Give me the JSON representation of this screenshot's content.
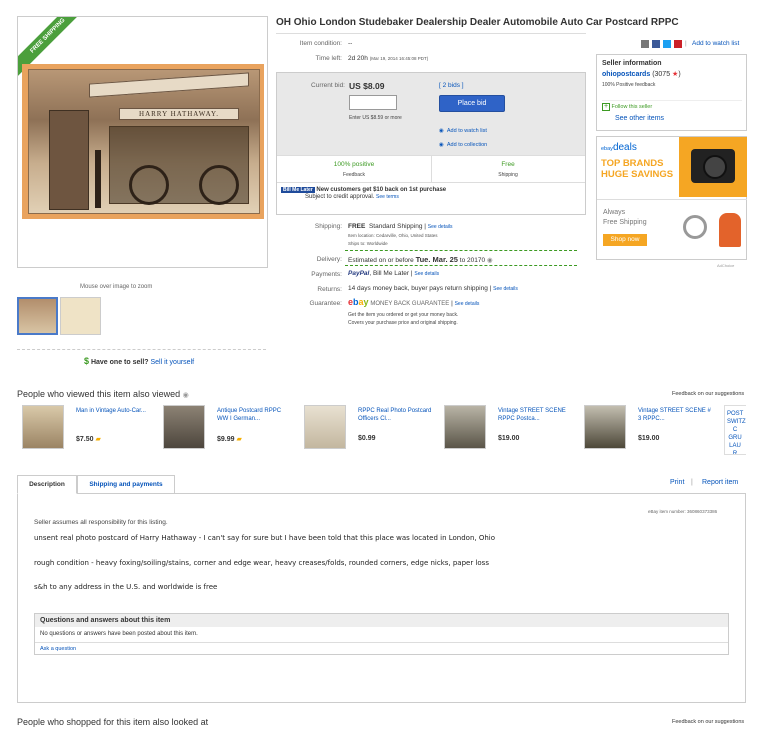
{
  "title": "OH Ohio London Studebaker Dealership Dealer Automobile Auto Car Postcard RPPC",
  "image": {
    "ribbon": "FREE SHIPPING",
    "sign_text": "HARRY HATHAWAY.",
    "zoom_hint": "Mouse over image to zoom"
  },
  "sell": {
    "prompt": "Have one to sell?",
    "link": "Sell it yourself",
    "icon": "$"
  },
  "details": {
    "condition_label": "Item condition:",
    "condition_value": "--",
    "time_left_label": "Time left:",
    "time_left_value": "2d 20h",
    "time_left_end": "(Mar 19, 2014   16:45:08 PDT)"
  },
  "bid": {
    "current_label": "Current bid:",
    "price": "US $8.09",
    "bids": "[ 2 bids ]",
    "hint": "Enter US $8.59 or more",
    "button": "Place bid",
    "watch": "Add to watch list",
    "collection": "Add to collection"
  },
  "feedback": {
    "positive": "100% positive",
    "positive_sub": "Feedback",
    "shipping": "Free",
    "shipping_sub": "Shipping"
  },
  "billme": {
    "logo": "Bill Me Later",
    "headline": "New customers get $10 back on 1st purchase",
    "sub": "Subject to credit approval.",
    "terms": "See terms"
  },
  "shipping": {
    "label": "Shipping:",
    "free": "FREE",
    "method": "Standard Shipping",
    "details": "See details",
    "location": "Item location:  Cedarville, Ohio, United States",
    "ships_to": "Ships to:  Worldwide"
  },
  "delivery": {
    "label": "Delivery:",
    "text": "Estimated on or before",
    "date": "Tue. Mar. 25",
    "zip": "to 20170"
  },
  "payments": {
    "label": "Payments:",
    "paypal": "PayPal",
    "bml": "Bill Me Later",
    "details": "See details"
  },
  "returns": {
    "label": "Returns:",
    "text": "14 days money back, buyer pays return shipping",
    "details": "See details"
  },
  "guarantee": {
    "label": "Guarantee:",
    "logo": "ebay",
    "text": "MONEY BACK GUARANTEE",
    "details": "See details",
    "line1": "Get the item you ordered or get your money back.",
    "line2": "Covers your purchase price and original shipping."
  },
  "share": {
    "watch": "Add to watch list",
    "sep": "|"
  },
  "seller": {
    "heading": "Seller information",
    "name": "ohiopostcards",
    "score": "(3075",
    "score_end": ")",
    "positive": "100% Positive feedback",
    "follow": "Follow this seller",
    "other": "See other items"
  },
  "ad": {
    "brand": "ebay",
    "deals": "deals",
    "headline": "TOP BRANDS HUGE SAVINGS",
    "always": "Always",
    "free": "Free Shipping",
    "button": "Shop now",
    "feedback": "AdChoice"
  },
  "viewed": {
    "title": "People who viewed this item also viewed",
    "feedback": "Feedback on our suggestions",
    "items": [
      {
        "title": "Man in Vintage Auto-Car...",
        "price": "$7.50"
      },
      {
        "title": "Antique Postcard RPPC WW I German...",
        "price": "$9.99"
      },
      {
        "title": "RPPC Real Photo Postcard Officers Cl...",
        "price": "$0.99"
      },
      {
        "title": "Vintage STREET SCENE RPPC Postca...",
        "price": "$19.00"
      },
      {
        "title": "Vintage STREET SCENE # 3 RPPC...",
        "price": "$19.00"
      }
    ],
    "partial": "POST SWITZ C GRU LAU R"
  },
  "tabs": {
    "description": "Description",
    "shipping": "Shipping and payments",
    "print": "Print",
    "report": "Report item"
  },
  "description": {
    "item_number_label": "eBay item number:",
    "item_number": "360860373386",
    "disclaimer": "Seller assumes all responsibility for this listing.",
    "line1": "unsent real photo postcard of Harry Hathaway -  I can't say for sure but I have been told that this place was located in London, Ohio",
    "line2": "rough condition - heavy foxing/soiling/stains, corner and edge wear, heavy creases/folds, rounded corners, edge nicks, paper loss",
    "line3": "s&h to any address in the U.S. and worldwide is free"
  },
  "qa": {
    "heading": "Questions and answers about this item",
    "none": "No questions or answers have been posted about this item.",
    "ask": "Ask a question"
  },
  "shopped": {
    "title": "People who shopped for this item also looked at",
    "feedback": "Feedback on our suggestions"
  },
  "colors": {
    "link": "#0654ba",
    "green": "#3c9a22",
    "button": "#2f63c7",
    "ribbon": "#4b9f3c",
    "ad_orange": "#f5a623"
  }
}
